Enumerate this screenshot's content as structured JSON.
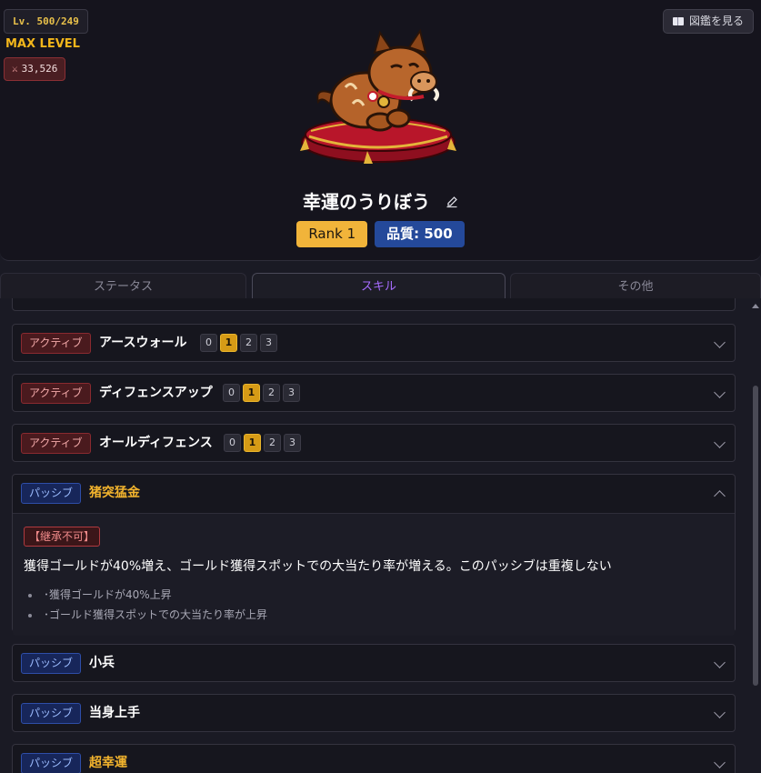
{
  "header": {
    "level": "Lv. 500/249",
    "max_level": "MAX LEVEL",
    "power": "33,526",
    "zukan_button": "図鑑を見る",
    "character_name": "幸運のうりぼう",
    "rank": "Rank 1",
    "quality": "品質: 500"
  },
  "tabs": [
    {
      "label": "ステータス"
    },
    {
      "label": "スキル"
    },
    {
      "label": "その他"
    }
  ],
  "skills": [
    {
      "type": "アクティブ",
      "name": "アースウォール",
      "levels": [
        "0",
        "1",
        "2",
        "3"
      ],
      "current": "1"
    },
    {
      "type": "アクティブ",
      "name": "ディフェンスアップ",
      "levels": [
        "0",
        "1",
        "2",
        "3"
      ],
      "current": "1"
    },
    {
      "type": "アクティブ",
      "name": "オールディフェンス",
      "levels": [
        "0",
        "1",
        "2",
        "3"
      ],
      "current": "1"
    },
    {
      "type": "パッシブ",
      "name": "猪突猛金",
      "expanded": true,
      "note": "【継承不可】",
      "description": "獲得ゴールドが40%増え、ゴールド獲得スポットでの大当たり率が増える。このパッシブは重複しない",
      "effects": [
        "･獲得ゴールドが40%上昇",
        "･ゴールド獲得スポットでの大当たり率が上昇"
      ]
    },
    {
      "type": "パッシブ",
      "name": "小兵"
    },
    {
      "type": "パッシブ",
      "name": "当身上手"
    },
    {
      "type": "パッシブ",
      "name": "超幸運"
    }
  ],
  "colors": {
    "accent_purple": "#a76cff",
    "gold": "#f3b42d",
    "active_red": "#8a2a30",
    "passive_blue": "#2e4ea8"
  }
}
